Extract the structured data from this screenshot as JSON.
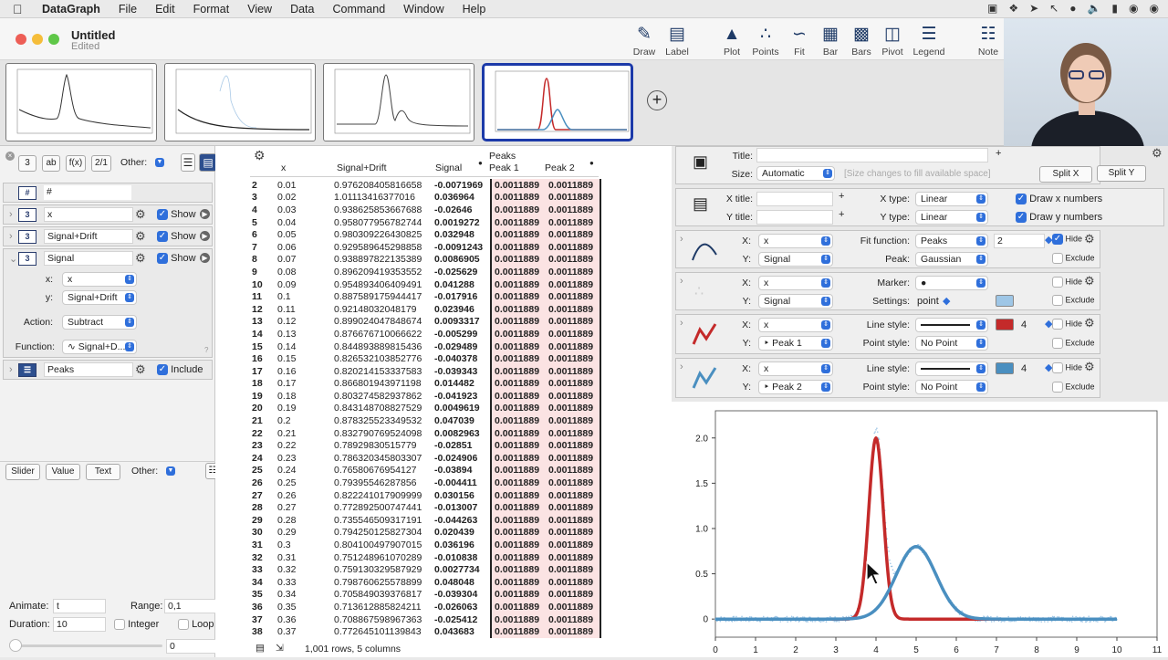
{
  "menubar": {
    "app": "DataGraph",
    "items": [
      "File",
      "Edit",
      "Format",
      "View",
      "Data",
      "Command",
      "Window",
      "Help"
    ]
  },
  "window": {
    "title": "Untitled",
    "subtitle": "Edited"
  },
  "toolbar": {
    "draw": "Draw",
    "label": "Label",
    "plot": "Plot",
    "points": "Points",
    "fit": "Fit",
    "bar": "Bar",
    "bars": "Bars",
    "pivot": "Pivot",
    "legend": "Legend",
    "note": "Note"
  },
  "left": {
    "other_label": "Other:",
    "cols": {
      "index": "#",
      "x": "x",
      "x_show": "Show",
      "sd": "Signal+Drift",
      "sd_show": "Show",
      "signal": "Signal",
      "signal_show": "Show",
      "x_label": "x:",
      "x_value": "x",
      "y_label": "y:",
      "y_value": "Signal+Drift",
      "action_label": "Action:",
      "action_value": "Subtract",
      "function_label": "Function:",
      "function_value": "Signal+D...",
      "peaks": "Peaks",
      "peaks_include": "Include"
    },
    "bottom": {
      "slider": "Slider",
      "value": "Value",
      "text": "Text",
      "other": "Other:",
      "animate_label": "Animate:",
      "animate_value": "t",
      "range_label": "Range:",
      "range_value": "0,1",
      "duration_label": "Duration:",
      "duration_value": "10",
      "integer": "Integer",
      "loop": "Loop",
      "slider_value": "0"
    }
  },
  "table": {
    "headers": {
      "x": "x",
      "sd": "Signal+Drift",
      "signal": "Signal",
      "group": "Peaks",
      "p1": "Peak 1",
      "p2": "Peak 2"
    },
    "rows": [
      [
        "2",
        "0.01",
        "0.976208405816658",
        "-0.0071969",
        "0.0011889",
        "0.0011889"
      ],
      [
        "3",
        "0.02",
        "1.01113416377016",
        "0.036964",
        "0.0011889",
        "0.0011889"
      ],
      [
        "4",
        "0.03",
        "0.938625853667688",
        "-0.02646",
        "0.0011889",
        "0.0011889"
      ],
      [
        "5",
        "0.04",
        "0.958077956782744",
        "0.0019272",
        "0.0011889",
        "0.0011889"
      ],
      [
        "6",
        "0.05",
        "0.980309226430825",
        "0.032948",
        "0.0011889",
        "0.0011889"
      ],
      [
        "7",
        "0.06",
        "0.929589645298858",
        "-0.0091243",
        "0.0011889",
        "0.0011889"
      ],
      [
        "8",
        "0.07",
        "0.938897822135389",
        "0.0086905",
        "0.0011889",
        "0.0011889"
      ],
      [
        "9",
        "0.08",
        "0.896209419353552",
        "-0.025629",
        "0.0011889",
        "0.0011889"
      ],
      [
        "10",
        "0.09",
        "0.954893406409491",
        "0.041288",
        "0.0011889",
        "0.0011889"
      ],
      [
        "11",
        "0.1",
        "0.887589175944417",
        "-0.017916",
        "0.0011889",
        "0.0011889"
      ],
      [
        "12",
        "0.11",
        "0.92148032048179",
        "0.023946",
        "0.0011889",
        "0.0011889"
      ],
      [
        "13",
        "0.12",
        "0.899024047848674",
        "0.0093317",
        "0.0011889",
        "0.0011889"
      ],
      [
        "14",
        "0.13",
        "0.876676710066622",
        "-0.005299",
        "0.0011889",
        "0.0011889"
      ],
      [
        "15",
        "0.14",
        "0.844893889815436",
        "-0.029489",
        "0.0011889",
        "0.0011889"
      ],
      [
        "16",
        "0.15",
        "0.826532103852776",
        "-0.040378",
        "0.0011889",
        "0.0011889"
      ],
      [
        "17",
        "0.16",
        "0.820214153337583",
        "-0.039343",
        "0.0011889",
        "0.0011889"
      ],
      [
        "18",
        "0.17",
        "0.866801943971198",
        "0.014482",
        "0.0011889",
        "0.0011889"
      ],
      [
        "19",
        "0.18",
        "0.803274582937862",
        "-0.041923",
        "0.0011889",
        "0.0011889"
      ],
      [
        "20",
        "0.19",
        "0.843148708827529",
        "0.0049619",
        "0.0011889",
        "0.0011889"
      ],
      [
        "21",
        "0.2",
        "0.878325523349532",
        "0.047039",
        "0.0011889",
        "0.0011889"
      ],
      [
        "22",
        "0.21",
        "0.832790769524098",
        "0.0082963",
        "0.0011889",
        "0.0011889"
      ],
      [
        "23",
        "0.22",
        "0.78929830515779",
        "-0.02851",
        "0.0011889",
        "0.0011889"
      ],
      [
        "24",
        "0.23",
        "0.786320345803307",
        "-0.024906",
        "0.0011889",
        "0.0011889"
      ],
      [
        "25",
        "0.24",
        "0.76580676954127",
        "-0.03894",
        "0.0011889",
        "0.0011889"
      ],
      [
        "26",
        "0.25",
        "0.79395546287856",
        "-0.004411",
        "0.0011889",
        "0.0011889"
      ],
      [
        "27",
        "0.26",
        "0.822241017909999",
        "0.030156",
        "0.0011889",
        "0.0011889"
      ],
      [
        "28",
        "0.27",
        "0.772892500747441",
        "-0.013007",
        "0.0011889",
        "0.0011889"
      ],
      [
        "29",
        "0.28",
        "0.735546509317191",
        "-0.044263",
        "0.0011889",
        "0.0011889"
      ],
      [
        "30",
        "0.29",
        "0.794250125827304",
        "0.020439",
        "0.0011889",
        "0.0011889"
      ],
      [
        "31",
        "0.3",
        "0.804100497907015",
        "0.036196",
        "0.0011889",
        "0.0011889"
      ],
      [
        "32",
        "0.31",
        "0.751248961070289",
        "-0.010838",
        "0.0011889",
        "0.0011889"
      ],
      [
        "33",
        "0.32",
        "0.759130329587929",
        "0.0027734",
        "0.0011889",
        "0.0011889"
      ],
      [
        "34",
        "0.33",
        "0.798760625578899",
        "0.048048",
        "0.0011889",
        "0.0011889"
      ],
      [
        "35",
        "0.34",
        "0.705849039376817",
        "-0.039304",
        "0.0011889",
        "0.0011889"
      ],
      [
        "36",
        "0.35",
        "0.713612885824211",
        "-0.026063",
        "0.0011889",
        "0.0011889"
      ],
      [
        "37",
        "0.36",
        "0.708867598967363",
        "-0.025412",
        "0.0011889",
        "0.0011889"
      ],
      [
        "38",
        "0.37",
        "0.772645101139843",
        "0.043683",
        "0.0011889",
        "0.0011889"
      ]
    ],
    "status": "1,001 rows, 5 columns"
  },
  "settings": {
    "title_label": "Title:",
    "size_label": "Size:",
    "size_value": "Automatic",
    "size_hint": "[Size changes to fill available space]",
    "split_x": "Split X",
    "split_y": "Split Y",
    "xtitle_label": "X title:",
    "ytitle_label": "Y title:",
    "xtype_label": "X type:",
    "xtype_value": "Linear",
    "ytype_label": "Y type:",
    "ytype_value": "Linear",
    "draw_x": "Draw x numbers",
    "draw_y": "Draw y numbers",
    "fit": {
      "x_label": "X:",
      "x": "x",
      "y_label": "Y:",
      "y": "Signal",
      "func_label": "Fit function:",
      "func": "Peaks",
      "count": "2",
      "peak_label": "Peak:",
      "peak": "Gaussian",
      "hide": "Hide",
      "exclude": "Exclude"
    },
    "points": {
      "x_label": "X:",
      "x": "x",
      "y_label": "Y:",
      "y": "Signal",
      "marker_label": "Marker:",
      "settings_label": "Settings:",
      "settings": "point",
      "hide": "Hide",
      "exclude": "Exclude"
    },
    "plot1": {
      "x_label": "X:",
      "x": "x",
      "y_label": "Y:",
      "y": "Peak 1",
      "line_label": "Line style:",
      "width": "4",
      "point_label": "Point style:",
      "point": "No Point",
      "hide": "Hide",
      "exclude": "Exclude",
      "color": "#c42a2a"
    },
    "plot2": {
      "x_label": "X:",
      "x": "x",
      "y_label": "Y:",
      "y": "Peak 2",
      "line_label": "Line style:",
      "width": "4",
      "point_label": "Point style:",
      "point": "No Point",
      "hide": "Hide",
      "exclude": "Exclude",
      "color": "#4a8fc0"
    }
  },
  "chart_data": {
    "type": "line",
    "xlim": [
      0,
      11
    ],
    "ylim": [
      -0.2,
      2.3
    ],
    "x_ticks": [
      "0",
      "1",
      "2",
      "3",
      "4",
      "5",
      "6",
      "7",
      "8",
      "9",
      "10",
      "11"
    ],
    "y_ticks": [
      "0",
      "0.5",
      "1.0",
      "1.5",
      "2.0"
    ],
    "series": [
      {
        "color": "#c42a2a",
        "shape": "gaussian",
        "amplitude": 2.0,
        "center": 4.0,
        "sigma": 0.18,
        "x_range": [
          0,
          10
        ]
      },
      {
        "color": "#4a8fc0",
        "shape": "gaussian",
        "amplitude": 0.8,
        "center": 5.0,
        "sigma": 0.5,
        "x_range": [
          0,
          10
        ]
      }
    ],
    "scatter_color": "#9ec6e6"
  }
}
